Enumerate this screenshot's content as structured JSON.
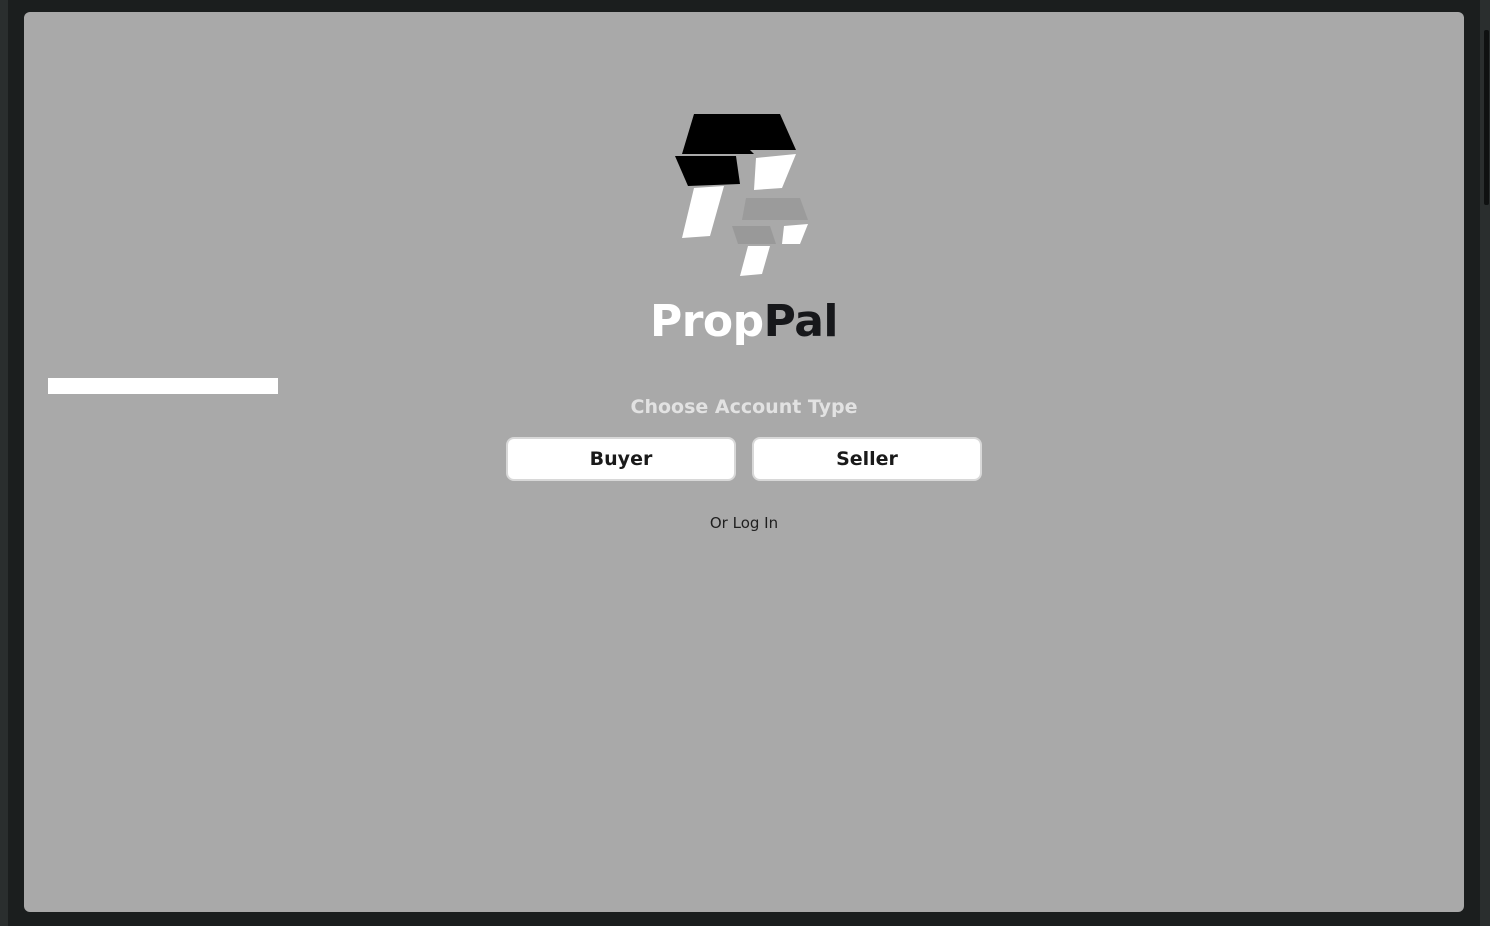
{
  "brand": {
    "name_part_1": "Prop",
    "name_part_2": "Pal",
    "logo_icon": "proppal-logo-icon"
  },
  "onboarding": {
    "heading": "Choose Account Type",
    "buyer_label": "Buyer",
    "seller_label": "Seller",
    "login_link": "Or Log In"
  },
  "colors": {
    "background": "#a9a9a9",
    "frame": "#1b1e1e",
    "button_bg": "#ffffff",
    "brand_light": "#ffffff",
    "brand_dark": "#17181b"
  }
}
